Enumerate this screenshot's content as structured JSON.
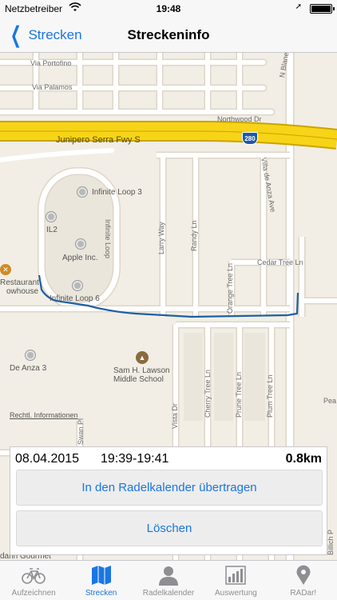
{
  "status_bar": {
    "carrier": "Netzbetreiber",
    "time": "19:48"
  },
  "nav": {
    "back_label": "Strecken",
    "title": "Streckeninfo"
  },
  "map": {
    "freeway": "Junipero Serra Fwy S",
    "route_shield": "280",
    "pois": {
      "infinite_loop_3": "Infinite Loop 3",
      "il2": "IL2",
      "apple": "Apple Inc.",
      "infinite_loop_6": "Infinite Loop 6",
      "restaurant_line1": "Restaurant",
      "restaurant_line2": "owhouse",
      "de_anza": "De Anza 3",
      "school_line1": "Sam H. Lawson",
      "school_line2": "Middle School",
      "mandarin": "darin Gourmet"
    },
    "streets": {
      "via_portofino": "Via Portofino",
      "via_palamos": "Via Palamos",
      "n_blaney": "N Blaney A",
      "northwood": "Northwood Dr",
      "infinite_loop": "Infinite Loop",
      "larry": "Larry Way",
      "randy": "Randy Ln",
      "orange": "Orange Tree Ln",
      "cedar": "Cedar Tree Ln",
      "villa": "Villa de Anza Ave",
      "vista": "Vista Dr",
      "cherry": "Cherry Tree Ln",
      "prune": "Prune Tree Ln",
      "plum": "Plum Tree Ln",
      "swan": "Swan Pl",
      "pear": "Pea",
      "billich": "Billich P"
    },
    "legal_link": "Rechtl. Informationen",
    "colors": {
      "route": "#1d5fa8",
      "freeway": "#f7d417",
      "road": "#ffffff",
      "land": "#f2eee5"
    }
  },
  "route_info": {
    "date": "08.04.2015",
    "time_range": "19:39-19:41",
    "distance": "0.8km",
    "calendar_button": "In den Radelkalender übertragen",
    "delete_button": "Löschen"
  },
  "tabs": [
    {
      "label": "Aufzeichnen",
      "icon": "bicycle-icon"
    },
    {
      "label": "Strecken",
      "icon": "map-icon"
    },
    {
      "label": "Radelkalender",
      "icon": "person-icon"
    },
    {
      "label": "Auswertung",
      "icon": "bar-chart-icon"
    },
    {
      "label": "RADar!",
      "icon": "location-pin-icon"
    }
  ],
  "accent_color": "#1a76e3"
}
